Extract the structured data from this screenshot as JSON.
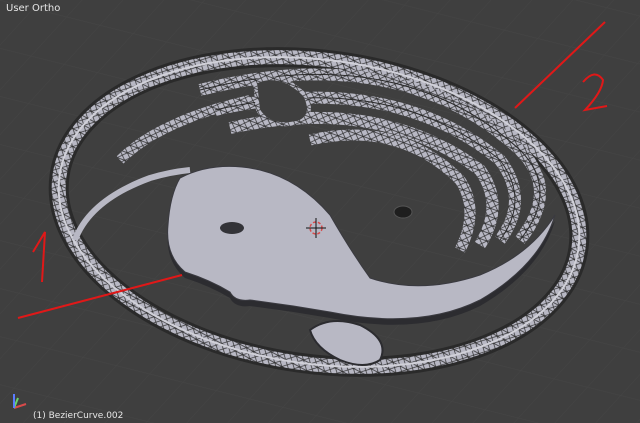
{
  "viewport": {
    "view_label": "User Ortho",
    "selection_label": "(1) BezierCurve.002"
  },
  "annotations": {
    "label_1": "1",
    "label_2": "2"
  },
  "colors": {
    "background": "#3f3f3f",
    "grid": "#474747",
    "mesh_fill": "#b8b8c4",
    "mesh_edge": "#2c2c2c",
    "annotation": "#e01818",
    "axis_x": "#d84a4a",
    "axis_y": "#6bd36b",
    "axis_z": "#5b7cff"
  },
  "icons": {
    "cursor": "3d-cursor-icon",
    "axis": "axis-gizmo-icon"
  }
}
